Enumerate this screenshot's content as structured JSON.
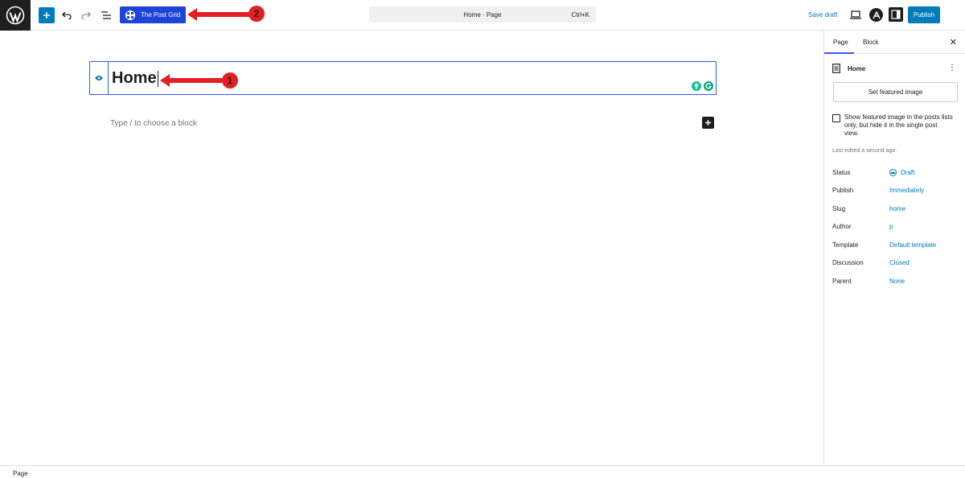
{
  "toolbar": {
    "plugin_button": "The Post Grid",
    "document_title": "Home · Page",
    "shortcut": "Ctrl+K",
    "save_draft": "Save draft",
    "publish": "Publish"
  },
  "annotations": [
    {
      "number": "1",
      "color": "#e31e24"
    },
    {
      "number": "2",
      "color": "#e31e24"
    }
  ],
  "editor": {
    "title": "Home",
    "placeholder": "Type / to choose a block"
  },
  "sidebar": {
    "tabs": [
      "Page",
      "Block"
    ],
    "doc_title": "Home",
    "featured_image_button": "Set featured image",
    "checkbox_label": "Show featured image in the posts lists only, but hide it in the single post view.",
    "last_edited": "Last edited a second ago.",
    "properties": [
      {
        "label": "Status",
        "value": "Draft"
      },
      {
        "label": "Publish",
        "value": "Immediately"
      },
      {
        "label": "Slug",
        "value": "home"
      },
      {
        "label": "Author",
        "value": "p"
      },
      {
        "label": "Template",
        "value": "Default template"
      },
      {
        "label": "Discussion",
        "value": "Closed"
      },
      {
        "label": "Parent",
        "value": "None"
      }
    ]
  },
  "statusbar": {
    "breadcrumb": "Page"
  },
  "colors": {
    "accent": "#007cba",
    "plugin": "#1d44d8",
    "annotation": "#e31e24"
  }
}
